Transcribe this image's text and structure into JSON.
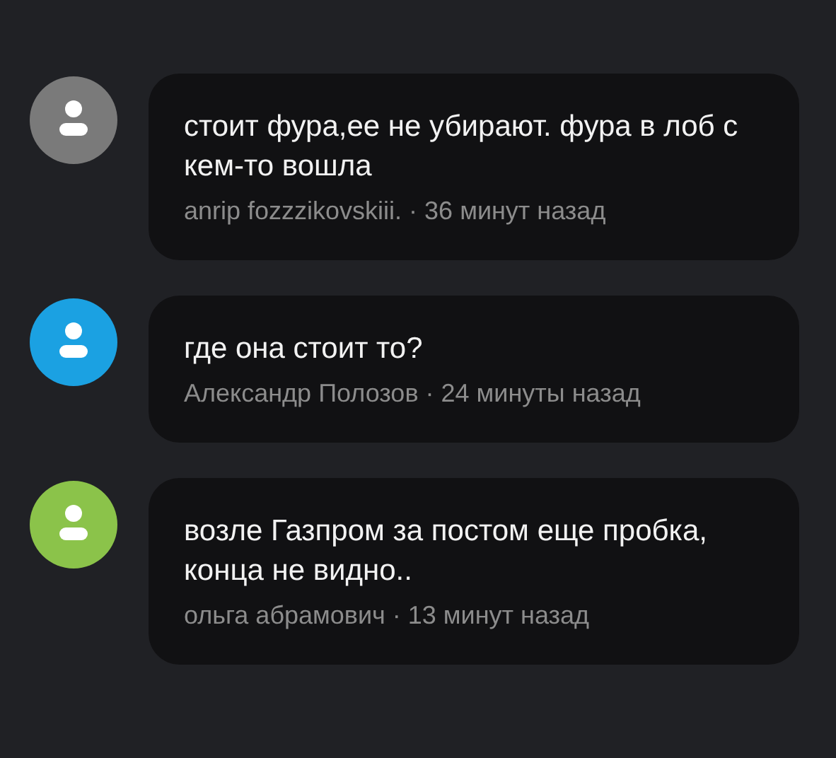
{
  "comments": [
    {
      "color": "#7a7a7a",
      "text": "стоит фура,ее не убирают. фура в лоб с кем-то вошла",
      "meta": "anrip fozzzikovskiii. · 36 минут назад"
    },
    {
      "color": "#1ba1e2",
      "text": "где она стоит то?",
      "meta": "Александр Полозов · 24 минуты назад"
    },
    {
      "color": "#8bc34a",
      "text": "возле Газпром за постом еще пробка,  конца не видно..",
      "meta": "ольга абрамович · 13 минут назад"
    }
  ]
}
